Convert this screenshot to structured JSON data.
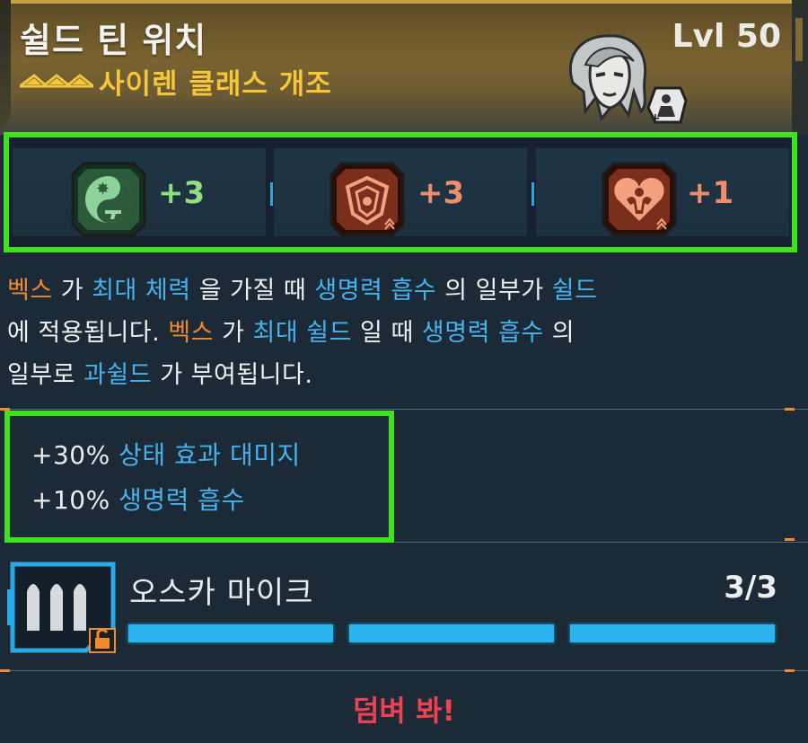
{
  "header": {
    "item_name": "쉴드 틴 위치",
    "item_class": "사이렌 클래스 개조",
    "level": "Lvl 50",
    "rarity_icon": "triple-chevron-rarity-icon",
    "portrait_icon": "siren-portrait-icon",
    "badge_icon": "class-mod-badge-icon"
  },
  "skills": [
    {
      "icon": "yin-yang-gun-skill-icon",
      "bonus": "+3",
      "theme": "green"
    },
    {
      "icon": "shield-emblem-skill-icon",
      "bonus": "+3",
      "theme": "orange"
    },
    {
      "icon": "heart-muscle-skill-icon",
      "bonus": "+1",
      "theme": "orange"
    }
  ],
  "description": {
    "l1": [
      "벡스",
      " 가 ",
      "최대 체력",
      " 을 가질 때 ",
      "생명력 흡수",
      " 의 일부가 ",
      "쉴드"
    ],
    "l2": [
      "에 적용됩니다. ",
      "벡스",
      " 가 ",
      "최대 쉴드",
      " 일 때 ",
      "생명력 흡수",
      " 의"
    ],
    "l3": [
      "일부로 ",
      "과쉴드",
      " 가 부여됩니다."
    ]
  },
  "stats": [
    {
      "value": "+30%",
      "name": "상태 효과 대미지"
    },
    {
      "value": "+10%",
      "name": "생명력 흡수"
    }
  ],
  "anointment": {
    "name": "오스카 마이크",
    "count": "3/3",
    "icon": "ammo-rounds-icon",
    "lock_icon": "lock-icon",
    "charges_filled": 3,
    "charges_total": 3
  },
  "flavor_text": "덤벼 봐!",
  "colors": {
    "highlight_box": "#3ee21d",
    "keyword_blue": "#46b2ec",
    "keyword_orange": "#f0882e",
    "class_gold": "#f5c53a",
    "flavor_red": "#ee4152"
  }
}
